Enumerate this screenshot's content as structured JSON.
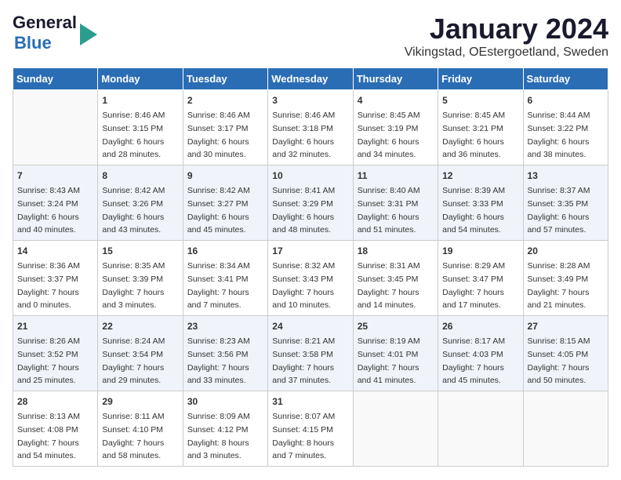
{
  "header": {
    "logo_line1": "General",
    "logo_line2": "Blue",
    "month_title": "January 2024",
    "location": "Vikingstad, OEstergoetland, Sweden"
  },
  "days_of_week": [
    "Sunday",
    "Monday",
    "Tuesday",
    "Wednesday",
    "Thursday",
    "Friday",
    "Saturday"
  ],
  "weeks": [
    [
      {
        "day": "",
        "sunrise": "",
        "sunset": "",
        "daylight": ""
      },
      {
        "day": "1",
        "sunrise": "8:46 AM",
        "sunset": "3:15 PM",
        "daylight": "6 hours and 28 minutes."
      },
      {
        "day": "2",
        "sunrise": "8:46 AM",
        "sunset": "3:17 PM",
        "daylight": "6 hours and 30 minutes."
      },
      {
        "day": "3",
        "sunrise": "8:46 AM",
        "sunset": "3:18 PM",
        "daylight": "6 hours and 32 minutes."
      },
      {
        "day": "4",
        "sunrise": "8:45 AM",
        "sunset": "3:19 PM",
        "daylight": "6 hours and 34 minutes."
      },
      {
        "day": "5",
        "sunrise": "8:45 AM",
        "sunset": "3:21 PM",
        "daylight": "6 hours and 36 minutes."
      },
      {
        "day": "6",
        "sunrise": "8:44 AM",
        "sunset": "3:22 PM",
        "daylight": "6 hours and 38 minutes."
      }
    ],
    [
      {
        "day": "7",
        "sunrise": "8:43 AM",
        "sunset": "3:24 PM",
        "daylight": "6 hours and 40 minutes."
      },
      {
        "day": "8",
        "sunrise": "8:42 AM",
        "sunset": "3:26 PM",
        "daylight": "6 hours and 43 minutes."
      },
      {
        "day": "9",
        "sunrise": "8:42 AM",
        "sunset": "3:27 PM",
        "daylight": "6 hours and 45 minutes."
      },
      {
        "day": "10",
        "sunrise": "8:41 AM",
        "sunset": "3:29 PM",
        "daylight": "6 hours and 48 minutes."
      },
      {
        "day": "11",
        "sunrise": "8:40 AM",
        "sunset": "3:31 PM",
        "daylight": "6 hours and 51 minutes."
      },
      {
        "day": "12",
        "sunrise": "8:39 AM",
        "sunset": "3:33 PM",
        "daylight": "6 hours and 54 minutes."
      },
      {
        "day": "13",
        "sunrise": "8:37 AM",
        "sunset": "3:35 PM",
        "daylight": "6 hours and 57 minutes."
      }
    ],
    [
      {
        "day": "14",
        "sunrise": "8:36 AM",
        "sunset": "3:37 PM",
        "daylight": "7 hours and 0 minutes."
      },
      {
        "day": "15",
        "sunrise": "8:35 AM",
        "sunset": "3:39 PM",
        "daylight": "7 hours and 3 minutes."
      },
      {
        "day": "16",
        "sunrise": "8:34 AM",
        "sunset": "3:41 PM",
        "daylight": "7 hours and 7 minutes."
      },
      {
        "day": "17",
        "sunrise": "8:32 AM",
        "sunset": "3:43 PM",
        "daylight": "7 hours and 10 minutes."
      },
      {
        "day": "18",
        "sunrise": "8:31 AM",
        "sunset": "3:45 PM",
        "daylight": "7 hours and 14 minutes."
      },
      {
        "day": "19",
        "sunrise": "8:29 AM",
        "sunset": "3:47 PM",
        "daylight": "7 hours and 17 minutes."
      },
      {
        "day": "20",
        "sunrise": "8:28 AM",
        "sunset": "3:49 PM",
        "daylight": "7 hours and 21 minutes."
      }
    ],
    [
      {
        "day": "21",
        "sunrise": "8:26 AM",
        "sunset": "3:52 PM",
        "daylight": "7 hours and 25 minutes."
      },
      {
        "day": "22",
        "sunrise": "8:24 AM",
        "sunset": "3:54 PM",
        "daylight": "7 hours and 29 minutes."
      },
      {
        "day": "23",
        "sunrise": "8:23 AM",
        "sunset": "3:56 PM",
        "daylight": "7 hours and 33 minutes."
      },
      {
        "day": "24",
        "sunrise": "8:21 AM",
        "sunset": "3:58 PM",
        "daylight": "7 hours and 37 minutes."
      },
      {
        "day": "25",
        "sunrise": "8:19 AM",
        "sunset": "4:01 PM",
        "daylight": "7 hours and 41 minutes."
      },
      {
        "day": "26",
        "sunrise": "8:17 AM",
        "sunset": "4:03 PM",
        "daylight": "7 hours and 45 minutes."
      },
      {
        "day": "27",
        "sunrise": "8:15 AM",
        "sunset": "4:05 PM",
        "daylight": "7 hours and 50 minutes."
      }
    ],
    [
      {
        "day": "28",
        "sunrise": "8:13 AM",
        "sunset": "4:08 PM",
        "daylight": "7 hours and 54 minutes."
      },
      {
        "day": "29",
        "sunrise": "8:11 AM",
        "sunset": "4:10 PM",
        "daylight": "7 hours and 58 minutes."
      },
      {
        "day": "30",
        "sunrise": "8:09 AM",
        "sunset": "4:12 PM",
        "daylight": "8 hours and 3 minutes."
      },
      {
        "day": "31",
        "sunrise": "8:07 AM",
        "sunset": "4:15 PM",
        "daylight": "8 hours and 7 minutes."
      },
      {
        "day": "",
        "sunrise": "",
        "sunset": "",
        "daylight": ""
      },
      {
        "day": "",
        "sunrise": "",
        "sunset": "",
        "daylight": ""
      },
      {
        "day": "",
        "sunrise": "",
        "sunset": "",
        "daylight": ""
      }
    ]
  ]
}
